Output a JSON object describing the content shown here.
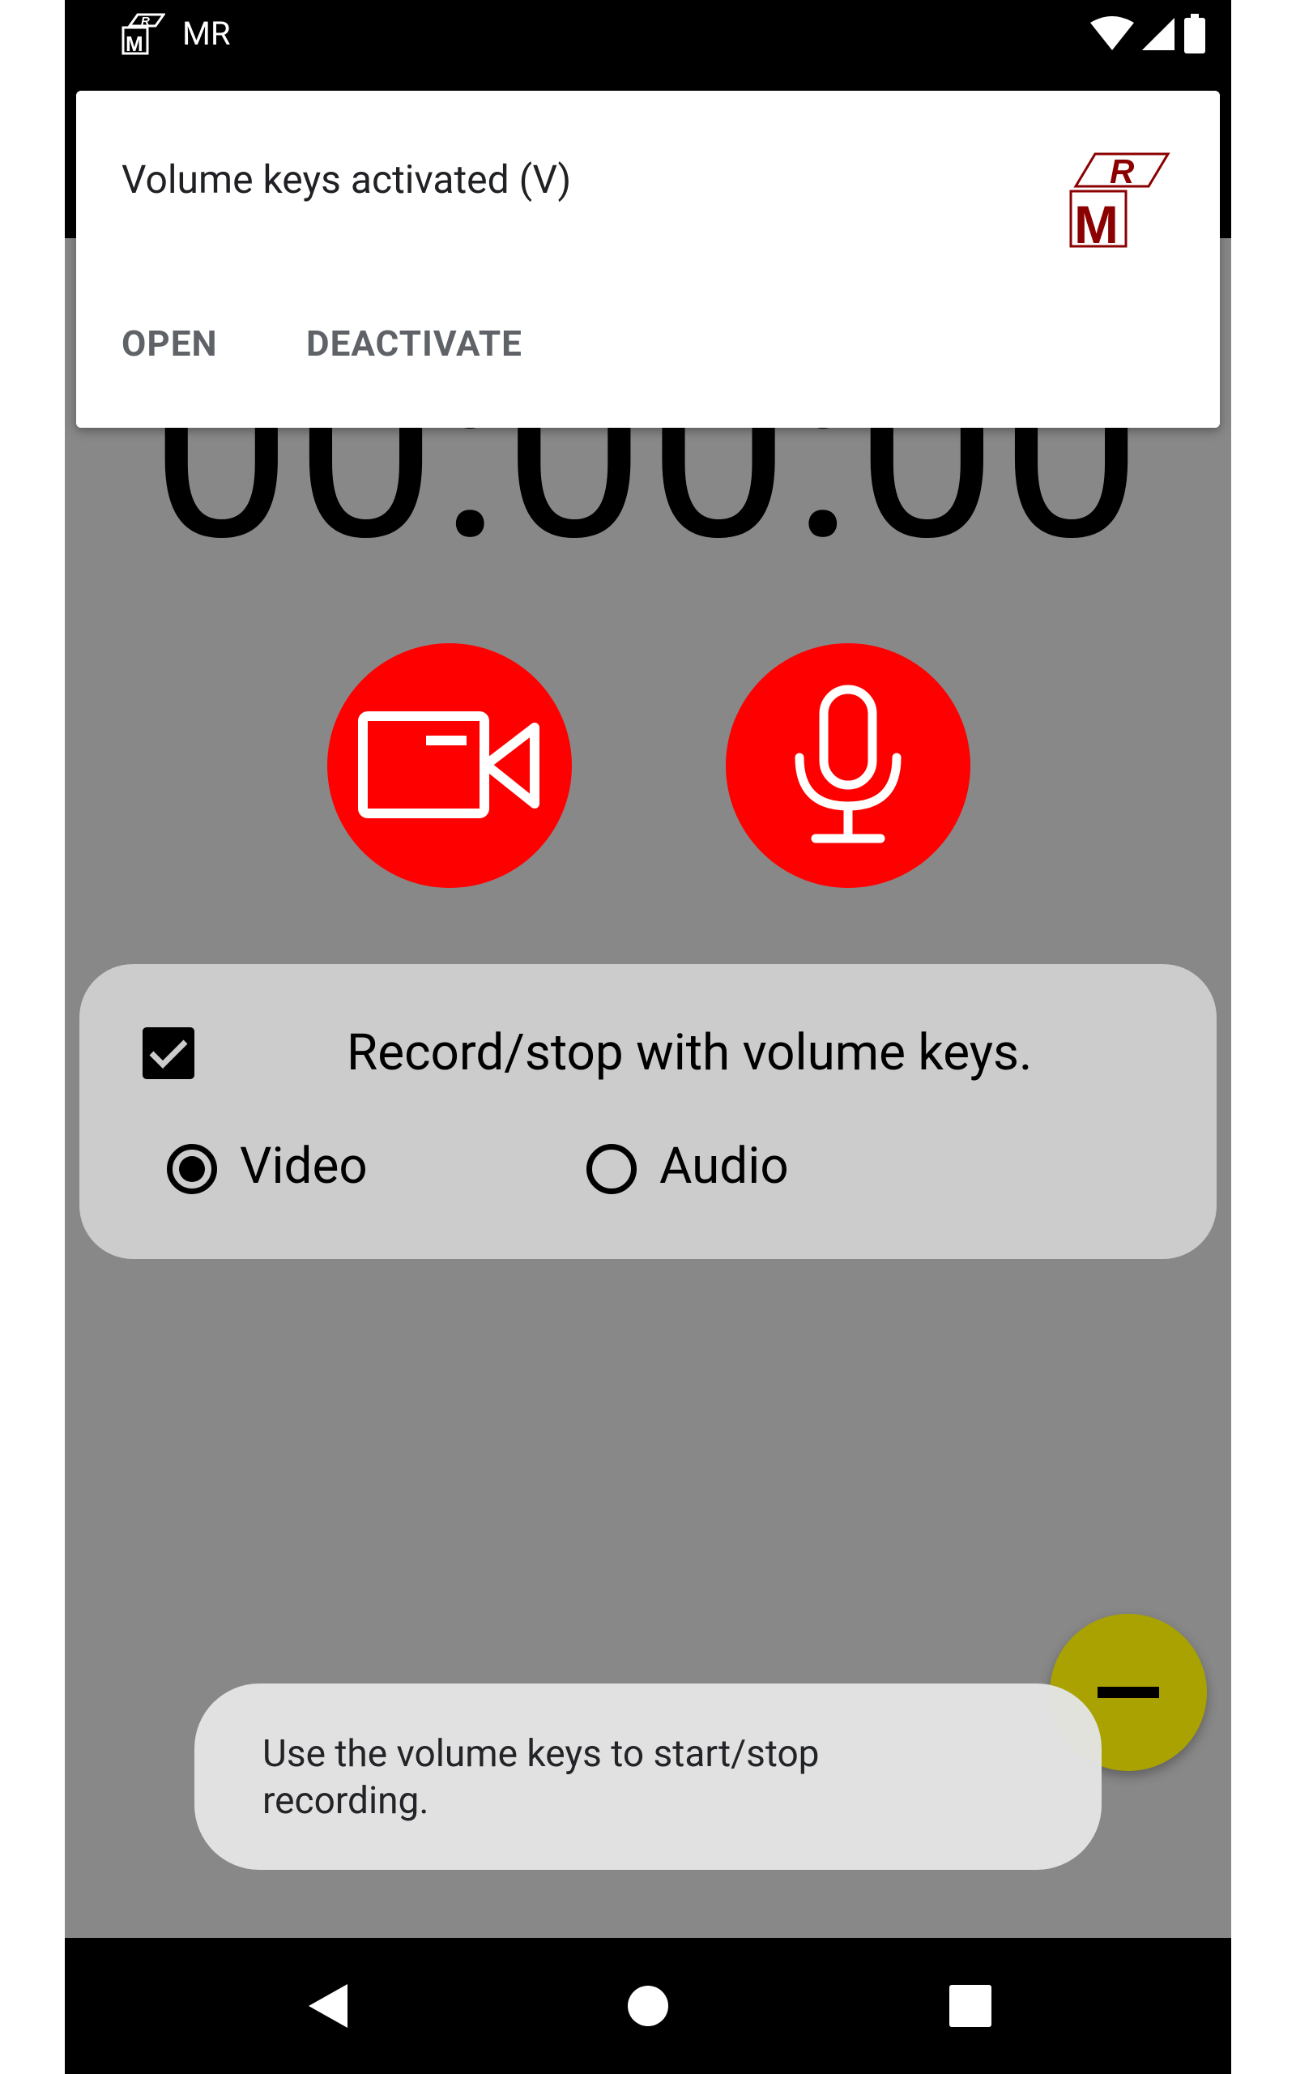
{
  "status_bar": {
    "app_label": "MR",
    "icons": [
      "app-logo-icon",
      "wifi-icon",
      "signal-icon",
      "battery-icon"
    ]
  },
  "notification": {
    "title": "Volume keys activated (V)",
    "logo_letters": "RM",
    "actions": {
      "open": "OPEN",
      "deactivate": "DEACTIVATE"
    }
  },
  "timer": {
    "display": "00:00:00"
  },
  "record_buttons": [
    {
      "name": "video",
      "icon": "video-camera-icon"
    },
    {
      "name": "audio",
      "icon": "microphone-icon"
    }
  ],
  "options": {
    "checkbox_label": "Record/stop with volume keys.",
    "checked": true,
    "modes": [
      {
        "label": "Video",
        "selected": true
      },
      {
        "label": "Audio",
        "selected": false
      }
    ]
  },
  "fab": {
    "icon": "minus-icon"
  },
  "toast": {
    "text": "Use the volume keys to start/stop recording."
  },
  "nav_bar": {
    "buttons": [
      "back-icon",
      "home-icon",
      "recents-icon"
    ]
  },
  "colors": {
    "record_red": "#ff0000",
    "fab_olive": "#aaa200",
    "background_gray": "#888888",
    "card_gray": "#cccccc",
    "logo_red": "#8b0000"
  }
}
